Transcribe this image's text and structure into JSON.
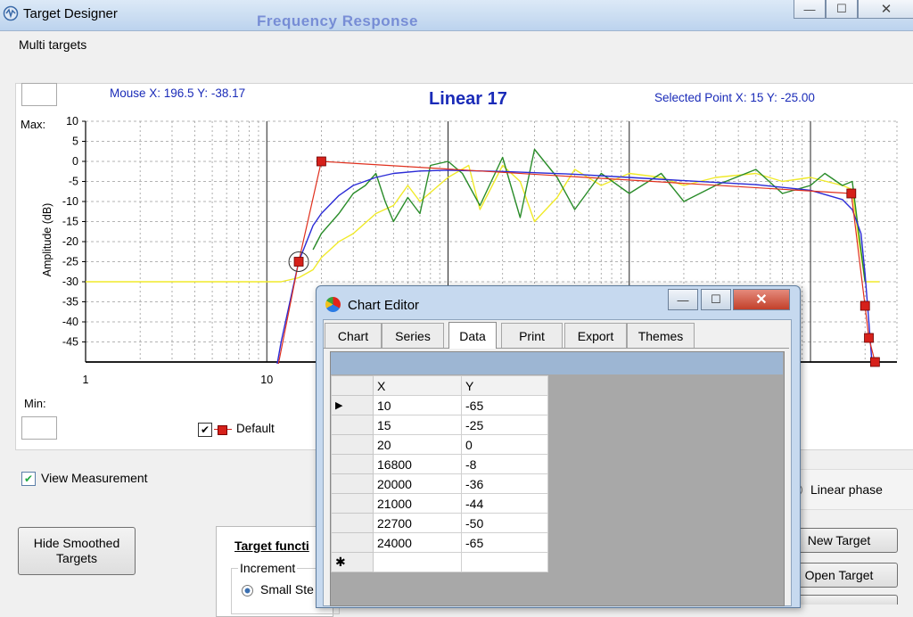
{
  "window": {
    "title": "Target Designer",
    "background_title": "Frequency Response",
    "controls": {
      "minimize": "—",
      "maximize": "☐",
      "close": "✕"
    }
  },
  "section_label": "Multi targets",
  "chart": {
    "mouse_readout": "Mouse  X: 196.5   Y: -38.17",
    "title": "Linear 17",
    "selected_readout": "Selected Point   X: 15   Y: -25.00",
    "max_label": "Max:",
    "min_label": "Min:",
    "ylabel": "Amplitude (dB)",
    "legend_label": "Default",
    "legend_checked": "✔"
  },
  "chart_data": {
    "type": "line",
    "title": "Linear 17",
    "ylabel": "Amplitude (dB)",
    "xlabel": "",
    "x_scale": "log",
    "xlim": [
      1,
      30000
    ],
    "ylim": [
      -50,
      10
    ],
    "y_ticks": [
      "10",
      "5",
      "0",
      "-5",
      "-10",
      "-15",
      "-20",
      "-25",
      "-30",
      "-35",
      "-40",
      "-45"
    ],
    "x_ticks": [
      "1",
      "10"
    ],
    "grid": true,
    "legend_position": "bottom-left",
    "series": [
      {
        "name": "Default",
        "color": "#e0301e",
        "marker": "square",
        "x": [
          10,
          15,
          20,
          16800,
          20000,
          21000,
          22700,
          24000
        ],
        "y": [
          -65,
          -25,
          0,
          -8,
          -36,
          -44,
          -50,
          -65
        ]
      },
      {
        "color": "#2b2bd6",
        "x": [
          10,
          12,
          15,
          18,
          20,
          25,
          30,
          40,
          50,
          70,
          100,
          200,
          500,
          1000,
          2000,
          5000,
          10000,
          15000,
          17000,
          19000,
          20000,
          21000,
          22000,
          23000
        ],
        "y": [
          -65,
          -45,
          -25,
          -16,
          -13,
          -8.5,
          -6,
          -4,
          -3,
          -2.4,
          -2.2,
          -2.5,
          -3.2,
          -4,
          -4.8,
          -5.8,
          -7.2,
          -9.5,
          -12,
          -18,
          -28,
          -40,
          -52,
          -65
        ]
      },
      {
        "color": "#2a8c2a",
        "x": [
          18,
          20,
          25,
          30,
          35,
          40,
          45,
          50,
          60,
          70,
          80,
          100,
          120,
          150,
          200,
          250,
          300,
          400,
          500,
          700,
          1000,
          1500,
          2000,
          3000,
          5000,
          7000,
          10000,
          12000,
          15000,
          17000,
          18500,
          20000
        ],
        "y": [
          -22,
          -18,
          -13,
          -8,
          -6,
          -3,
          -10,
          -15,
          -9,
          -13,
          -1,
          0,
          -3,
          -11,
          1,
          -14,
          3,
          -4,
          -12,
          -3,
          -8,
          -3,
          -10,
          -6,
          -2,
          -8,
          -6,
          -3,
          -6,
          -5,
          -18,
          -30
        ]
      },
      {
        "color": "#f0ea2a",
        "x": [
          1,
          10,
          12,
          15,
          18,
          20,
          25,
          30,
          40,
          50,
          60,
          70,
          100,
          130,
          150,
          200,
          250,
          300,
          400,
          500,
          700,
          1000,
          1500,
          2000,
          3000,
          5000,
          7000,
          10000,
          15000,
          17000,
          18500,
          20000,
          24000
        ],
        "y": [
          -30,
          -30,
          -30,
          -29,
          -27,
          -24,
          -20,
          -18,
          -13,
          -11,
          -6,
          -10,
          -4,
          -1,
          -12,
          -1,
          -5,
          -15,
          -9,
          -2,
          -6,
          -3,
          -4,
          -6,
          -4,
          -3,
          -5,
          -4,
          -6,
          -7,
          -20,
          -30,
          -30
        ]
      }
    ]
  },
  "view_measurement_label": "View Measurement",
  "view_measurement_checked": "✔",
  "hide_smoothed_label_1": "Hide Smoothed",
  "hide_smoothed_label_2": "Targets",
  "target_function_label": "Target functi",
  "increment_label": "Increment",
  "small_step_label": "Small Ste",
  "linear_phase_label": "Linear phase",
  "new_target_label": "New Target",
  "open_target_label": "Open Target",
  "editor": {
    "title": "Chart Editor",
    "tabs": [
      "Chart",
      "Series",
      "Data",
      "Print",
      "Export",
      "Themes"
    ],
    "active_tab": "Data",
    "columns": [
      "X",
      "Y"
    ],
    "rows": [
      {
        "x": "10",
        "y": "-65"
      },
      {
        "x": "15",
        "y": "-25"
      },
      {
        "x": "20",
        "y": "0"
      },
      {
        "x": "16800",
        "y": "-8"
      },
      {
        "x": "20000",
        "y": "-36"
      },
      {
        "x": "21000",
        "y": "-44"
      },
      {
        "x": "22700",
        "y": "-50"
      },
      {
        "x": "24000",
        "y": "-65"
      }
    ],
    "current_row_marker": "▶",
    "new_row_marker": "✱"
  }
}
